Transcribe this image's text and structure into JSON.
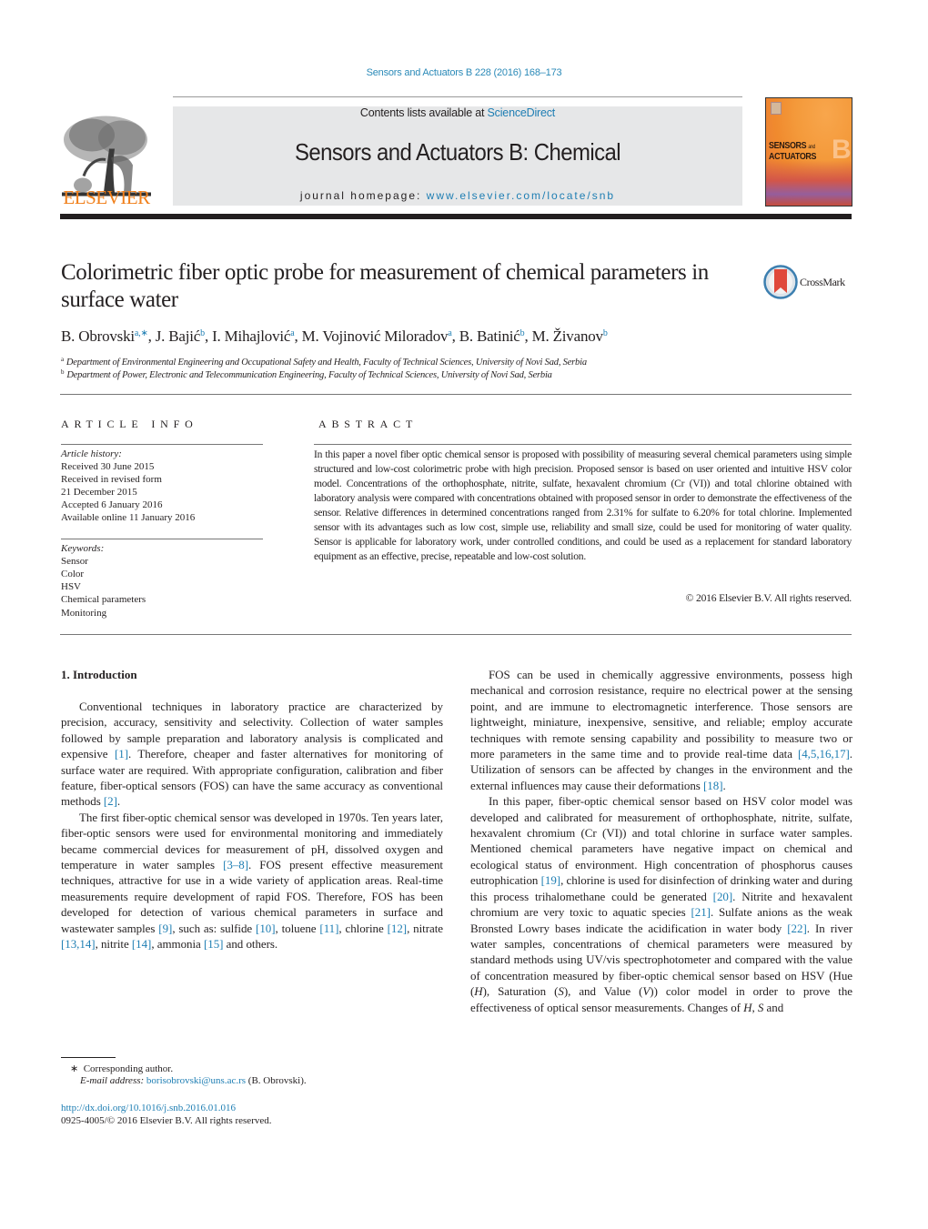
{
  "header": {
    "running_head": "Sensors and Actuators B 228 (2016) 168–173",
    "contents_prefix": "Contents lists available at ",
    "contents_link": "ScienceDirect",
    "journal_title": "Sensors and Actuators B: Chemical",
    "homepage_prefix": "journal homepage: ",
    "homepage_link": "www.elsevier.com/locate/snb",
    "publisher_logo_text": "ELSEVIER",
    "cover": {
      "line1": "SENSORS",
      "line1_small": "and",
      "line2": "ACTUATORS",
      "letter": "B"
    },
    "colors": {
      "link": "#1e7eb3",
      "elsevier_orange": "#f07f1a",
      "masthead_gray": "#e6e7e8"
    }
  },
  "article": {
    "title": "Colorimetric fiber optic probe for measurement of chemical parameters in surface water",
    "crossmark_label": "CrossMark",
    "authors": [
      {
        "name": "B. Obrovski",
        "sup": "a,∗"
      },
      {
        "name": "J. Bajić",
        "sup": "b"
      },
      {
        "name": "I. Mihajlović",
        "sup": "a"
      },
      {
        "name": "M. Vojinović Miloradov",
        "sup": "a"
      },
      {
        "name": "B. Batinić",
        "sup": "b"
      },
      {
        "name": "M. Živanov",
        "sup": "b"
      }
    ],
    "affiliations": [
      {
        "sup": "a",
        "text": "Department of Environmental Engineering and Occupational Safety and Health, Faculty of Technical Sciences, University of Novi Sad, Serbia"
      },
      {
        "sup": "b",
        "text": "Department of Power, Electronic and Telecommunication Engineering, Faculty of Technical Sciences, University of Novi Sad, Serbia"
      }
    ]
  },
  "article_info": {
    "heading": "ARTICLE INFO",
    "history_label": "Article history:",
    "history": [
      "Received 30 June 2015",
      "Received in revised form",
      "21 December 2015",
      "Accepted 6 January 2016",
      "Available online 11 January 2016"
    ],
    "keywords_label": "Keywords:",
    "keywords": [
      "Sensor",
      "Color",
      "HSV",
      "Chemical parameters",
      "Monitoring"
    ]
  },
  "abstract": {
    "heading": "ABSTRACT",
    "text": "In this paper a novel fiber optic chemical sensor is proposed with possibility of measuring several chem­ical parameters using simple structured and low-cost colorimetric probe with high precision. Proposed sensor is based on user oriented and intuitive HSV color model. Concentrations of the orthophosphate, nitrite, sulfate, hexavalent chromium (Cr (VI)) and total chlorine obtained with laboratory analysis were compared with concentrations obtained with proposed sensor in order to demonstrate the effectiveness of the sensor. Relative differences in determined concentrations ranged from 2.31% for sulfate to 6.20% for total chlorine. Implemented sensor with its advantages such as low cost, simple use, reliability and small size, could be used for monitoring of water quality. Sensor is applicable for laboratory work, under con­trolled conditions, and could be used as a replacement for standard laboratory equipment as an effective, precise, repeatable and low-cost solution.",
    "copyright": "© 2016 Elsevier B.V. All rights reserved."
  },
  "body": {
    "section_heading": "1.  Introduction",
    "left_paragraphs": [
      [
        {
          "t": "Conventional techniques in laboratory practice are character­ized by precision, accuracy, sensitivity and selectivity. Collection of water samples followed by sample preparation and laboratory analysis is complicated and expensive "
        },
        {
          "r": "[1]"
        },
        {
          "t": ". Therefore, cheaper and faster alternatives for monitoring of surface water are required. With appropriate configuration, calibration and fiber feature, fiber-optical sensors (FOS) can have the same accuracy as conventional methods "
        },
        {
          "r": "[2]"
        },
        {
          "t": "."
        }
      ],
      [
        {
          "t": "The first fiber-optic chemical sensor was developed in 1970s. Ten years later, fiber-optic sensors were used for environmen­tal monitoring and immediately became commercial devices for measurement of pH, dissolved oxygen and temperature in water samples "
        },
        {
          "r": "[3–8]"
        },
        {
          "t": ". FOS present effective measurement techniques, attractive for use in a wide variety of application areas. Real-time measurements require development of rapid FOS. Therefore, FOS has been developed for detection of various chemical parameters in surface and wastewater samples "
        },
        {
          "r": "[9]"
        },
        {
          "t": ", such as: sulfide "
        },
        {
          "r": "[10]"
        },
        {
          "t": ", toluene "
        },
        {
          "r": "[11]"
        },
        {
          "t": ", chlorine "
        },
        {
          "r": "[12]"
        },
        {
          "t": ", nitrate "
        },
        {
          "r": "[13,14]"
        },
        {
          "t": ", nitrite "
        },
        {
          "r": "[14]"
        },
        {
          "t": ", ammonia "
        },
        {
          "r": "[15]"
        },
        {
          "t": " and others."
        }
      ]
    ],
    "right_paragraphs": [
      [
        {
          "t": "FOS can be used in chemically aggressive environments, pos­sess high mechanical and corrosion resistance, require no electrical power at the sensing point, and are immune to electromagnetic interference. Those sensors are lightweight, miniature, inexpen­sive, sensitive, and reliable; employ accurate techniques with remote sensing capability and possibility to measure two or more parameters in the same time and to provide real-time data "
        },
        {
          "r": "[4,5,16,17]"
        },
        {
          "t": ". Utilization of sensors can be affected by changes in the environment and the external influences may cause their deforma­tions "
        },
        {
          "r": "[18]"
        },
        {
          "t": "."
        }
      ],
      [
        {
          "t": "In this paper, fiber-optic chemical sensor based on HSV color model was developed and calibrated for measurement of orthophosphate, nitrite, sulfate, hexavalent chromium (Cr (VI)) and total chlorine in surface water samples. Mentioned chemical parameters have negative impact on chemical and ecological status of environment. High concentration of phosphorus causes eutroph­ication "
        },
        {
          "r": "[19]"
        },
        {
          "t": ", chlorine is used for disinfection of drinking water and during this process trihalomethane could be generated "
        },
        {
          "r": "[20]"
        },
        {
          "t": ". Nitrite and hexavalent chromium are very toxic to aquatic species "
        },
        {
          "r": "[21]"
        },
        {
          "t": ". Sulfate anions as the weak Bronsted Lowry bases indicate the acid­ification in water body "
        },
        {
          "r": "[22]"
        },
        {
          "t": ". In river water samples, concentrations of chemical parameters were measured by standard methods using UV/vis spectrophotometer and compared with the value of concen­tration measured by fiber-optic chemical sensor based on HSV (Hue ("
        },
        {
          "i": "H"
        },
        {
          "t": "), Saturation ("
        },
        {
          "i": "S"
        },
        {
          "t": "), and Value ("
        },
        {
          "i": "V"
        },
        {
          "t": ")) color model in order to prove the effectiveness of optical sensor measurements. Changes of "
        },
        {
          "i": "H"
        },
        {
          "t": ", "
        },
        {
          "i": "S"
        },
        {
          "t": " and"
        }
      ]
    ]
  },
  "footnotes": {
    "corresponding_mark": "∗",
    "corresponding_text": "Corresponding author.",
    "email_label": "E-mail address: ",
    "email": "borisobrovski@uns.ac.rs",
    "email_suffix": " (B. Obrovski).",
    "doi": "http://dx.doi.org/10.1016/j.snb.2016.01.016",
    "issn_line": "0925-4005/© 2016 Elsevier B.V. All rights reserved."
  }
}
